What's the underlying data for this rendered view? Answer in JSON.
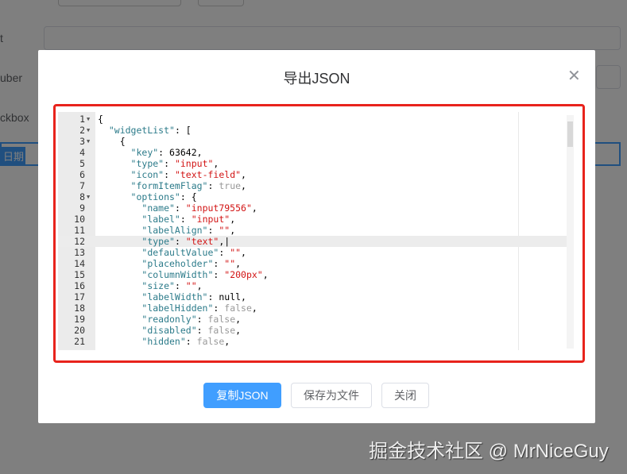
{
  "background": {
    "labels": [
      "t",
      "uber",
      "ckbox"
    ],
    "selected_field": "日期"
  },
  "dialog": {
    "title": "导出JSON",
    "close_icon": "close-icon",
    "code_lines": [
      {
        "n": "1",
        "fold": true,
        "indent": "",
        "tokens": [
          [
            "p",
            "{"
          ]
        ]
      },
      {
        "n": "2",
        "fold": true,
        "indent": "  ",
        "tokens": [
          [
            "k",
            "\"widgetList\""
          ],
          [
            "p",
            ": ["
          ]
        ]
      },
      {
        "n": "3",
        "fold": true,
        "indent": "    ",
        "tokens": [
          [
            "p",
            "{"
          ]
        ]
      },
      {
        "n": "4",
        "indent": "      ",
        "tokens": [
          [
            "k",
            "\"key\""
          ],
          [
            "p",
            ": "
          ],
          [
            "n",
            "63642"
          ],
          [
            "p",
            ","
          ]
        ]
      },
      {
        "n": "5",
        "indent": "      ",
        "tokens": [
          [
            "k",
            "\"type\""
          ],
          [
            "p",
            ": "
          ],
          [
            "s",
            "\"input\""
          ],
          [
            "p",
            ","
          ]
        ]
      },
      {
        "n": "6",
        "indent": "      ",
        "tokens": [
          [
            "k",
            "\"icon\""
          ],
          [
            "p",
            ": "
          ],
          [
            "s",
            "\"text-field\""
          ],
          [
            "p",
            ","
          ]
        ]
      },
      {
        "n": "7",
        "indent": "      ",
        "tokens": [
          [
            "k",
            "\"formItemFlag\""
          ],
          [
            "p",
            ": "
          ],
          [
            "b",
            "true"
          ],
          [
            "p",
            ","
          ]
        ]
      },
      {
        "n": "8",
        "fold": true,
        "indent": "      ",
        "tokens": [
          [
            "k",
            "\"options\""
          ],
          [
            "p",
            ": {"
          ]
        ]
      },
      {
        "n": "9",
        "indent": "        ",
        "tokens": [
          [
            "k",
            "\"name\""
          ],
          [
            "p",
            ": "
          ],
          [
            "s",
            "\"input79556\""
          ],
          [
            "p",
            ","
          ]
        ]
      },
      {
        "n": "10",
        "indent": "        ",
        "tokens": [
          [
            "k",
            "\"label\""
          ],
          [
            "p",
            ": "
          ],
          [
            "s",
            "\"input\""
          ],
          [
            "p",
            ","
          ]
        ]
      },
      {
        "n": "11",
        "indent": "        ",
        "tokens": [
          [
            "k",
            "\"labelAlign\""
          ],
          [
            "p",
            ": "
          ],
          [
            "s",
            "\"\""
          ],
          [
            "p",
            ","
          ]
        ]
      },
      {
        "n": "12",
        "active": true,
        "indent": "        ",
        "tokens": [
          [
            "k",
            "\"type\""
          ],
          [
            "p",
            ": "
          ],
          [
            "s",
            "\"text\""
          ],
          [
            "p",
            ",|"
          ]
        ]
      },
      {
        "n": "13",
        "indent": "        ",
        "tokens": [
          [
            "k",
            "\"defaultValue\""
          ],
          [
            "p",
            ": "
          ],
          [
            "s",
            "\"\""
          ],
          [
            "p",
            ","
          ]
        ]
      },
      {
        "n": "14",
        "indent": "        ",
        "tokens": [
          [
            "k",
            "\"placeholder\""
          ],
          [
            "p",
            ": "
          ],
          [
            "s",
            "\"\""
          ],
          [
            "p",
            ","
          ]
        ]
      },
      {
        "n": "15",
        "indent": "        ",
        "tokens": [
          [
            "k",
            "\"columnWidth\""
          ],
          [
            "p",
            ": "
          ],
          [
            "s",
            "\"200px\""
          ],
          [
            "p",
            ","
          ]
        ]
      },
      {
        "n": "16",
        "indent": "        ",
        "tokens": [
          [
            "k",
            "\"size\""
          ],
          [
            "p",
            ": "
          ],
          [
            "s",
            "\"\""
          ],
          [
            "p",
            ","
          ]
        ]
      },
      {
        "n": "17",
        "indent": "        ",
        "tokens": [
          [
            "k",
            "\"labelWidth\""
          ],
          [
            "p",
            ": "
          ],
          [
            "n",
            "null"
          ],
          [
            "p",
            ","
          ]
        ]
      },
      {
        "n": "18",
        "indent": "        ",
        "tokens": [
          [
            "k",
            "\"labelHidden\""
          ],
          [
            "p",
            ": "
          ],
          [
            "b",
            "false"
          ],
          [
            "p",
            ","
          ]
        ]
      },
      {
        "n": "19",
        "indent": "        ",
        "tokens": [
          [
            "k",
            "\"readonly\""
          ],
          [
            "p",
            ": "
          ],
          [
            "b",
            "false"
          ],
          [
            "p",
            ","
          ]
        ]
      },
      {
        "n": "20",
        "indent": "        ",
        "tokens": [
          [
            "k",
            "\"disabled\""
          ],
          [
            "p",
            ": "
          ],
          [
            "b",
            "false"
          ],
          [
            "p",
            ","
          ]
        ]
      },
      {
        "n": "21",
        "indent": "        ",
        "tokens": [
          [
            "k",
            "\"hidden\""
          ],
          [
            "p",
            ": "
          ],
          [
            "b",
            "false"
          ],
          [
            "p",
            ","
          ]
        ]
      }
    ],
    "buttons": {
      "copy": "复制JSON",
      "save": "保存为文件",
      "close": "关闭"
    }
  },
  "watermark": "掘金技术社区 @ MrNiceGuy",
  "colors": {
    "primary": "#409eff",
    "highlight_border": "#e8231c"
  }
}
